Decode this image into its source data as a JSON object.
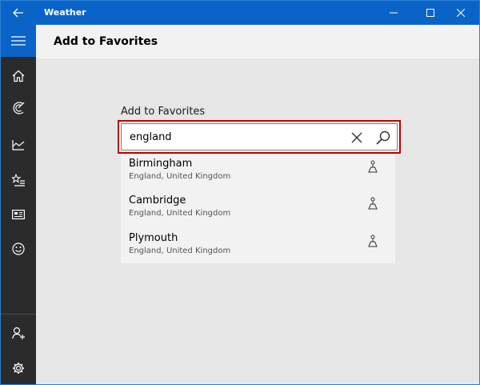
{
  "window": {
    "title": "Weather",
    "accent_color": "#0a64c8",
    "sidebar_color": "#2b2b2b",
    "highlight_color": "#c00000"
  },
  "titlebar": {
    "back_icon": "back-arrow-icon",
    "minimize_icon": "minimize-icon",
    "maximize_icon": "maximize-icon",
    "close_icon": "close-icon"
  },
  "sidebar": {
    "items": [
      {
        "name": "menu",
        "icon": "hamburger-icon"
      },
      {
        "name": "home",
        "icon": "home-icon"
      },
      {
        "name": "maps",
        "icon": "radar-icon"
      },
      {
        "name": "historical",
        "icon": "chart-icon"
      },
      {
        "name": "places",
        "icon": "favorites-icon"
      },
      {
        "name": "news",
        "icon": "news-icon"
      },
      {
        "name": "life",
        "icon": "smiley-icon"
      },
      {
        "name": "account",
        "icon": "add-user-icon"
      },
      {
        "name": "settings",
        "icon": "gear-icon"
      }
    ]
  },
  "header": {
    "title": "Add to Favorites"
  },
  "search": {
    "label": "Add to Favorites",
    "value": "england",
    "clear_icon": "clear-icon",
    "search_icon": "search-icon"
  },
  "results": [
    {
      "city": "Birmingham",
      "region": "England, United Kingdom",
      "icon": "location-icon"
    },
    {
      "city": "Cambridge",
      "region": "England, United Kingdom",
      "icon": "location-icon"
    },
    {
      "city": "Plymouth",
      "region": "England, United Kingdom",
      "icon": "location-icon"
    }
  ]
}
